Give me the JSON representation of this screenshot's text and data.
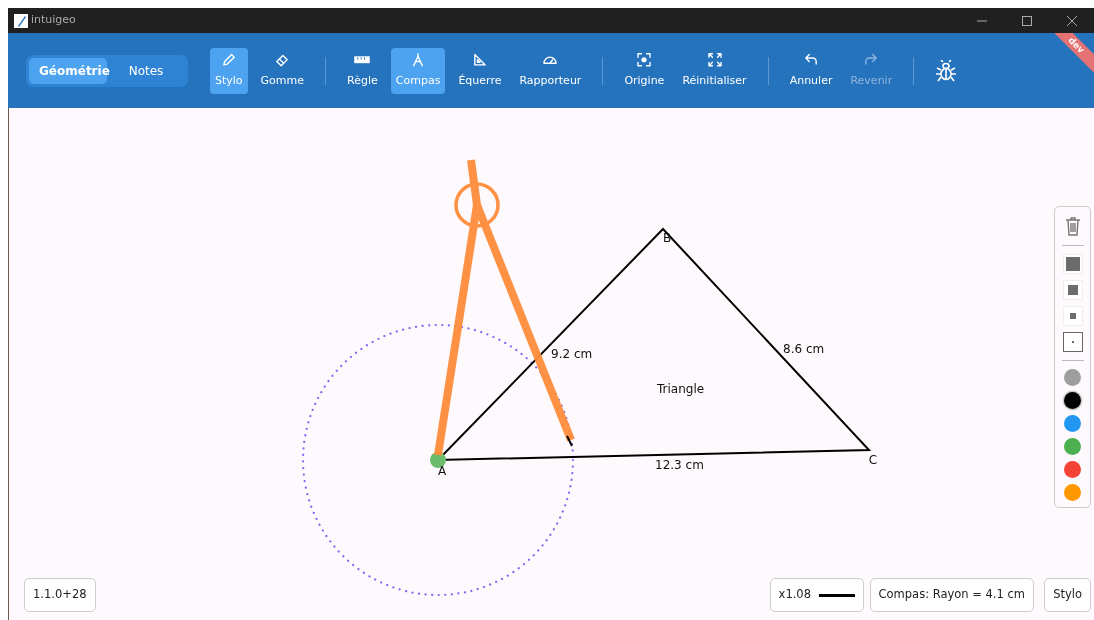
{
  "window": {
    "title": "intuigeo"
  },
  "modes": [
    {
      "label": "Géométrie",
      "selected": true
    },
    {
      "label": "Notes",
      "selected": false
    }
  ],
  "tool_groups": [
    {
      "tools": [
        {
          "kind": "pencil",
          "label": "Stylo",
          "selected": true,
          "disabled": false
        },
        {
          "kind": "eraser",
          "label": "Gomme",
          "selected": false,
          "disabled": false
        }
      ]
    },
    {
      "tools": [
        {
          "kind": "ruler",
          "label": "Règle",
          "selected": false,
          "disabled": false
        },
        {
          "kind": "compass",
          "label": "Compas",
          "selected": true,
          "disabled": false
        },
        {
          "kind": "setsquare",
          "label": "Équerre",
          "selected": false,
          "disabled": false
        },
        {
          "kind": "protractor",
          "label": "Rapporteur",
          "selected": false,
          "disabled": false
        }
      ]
    },
    {
      "tools": [
        {
          "kind": "target",
          "label": "Origine",
          "selected": false,
          "disabled": false
        },
        {
          "kind": "expand",
          "label": "Réinitialiser",
          "selected": false,
          "disabled": false
        }
      ]
    },
    {
      "tools": [
        {
          "kind": "undo",
          "label": "Annuler",
          "selected": false,
          "disabled": false
        },
        {
          "kind": "redo",
          "label": "Revenir",
          "selected": false,
          "disabled": true
        }
      ]
    }
  ],
  "ribbon": "dev",
  "drawing": {
    "points": [
      {
        "label": "A"
      },
      {
        "label": "B"
      },
      {
        "label": "C"
      }
    ],
    "lengths": [
      "9.2 cm",
      "8.6 cm",
      "12.3 cm"
    ],
    "shape_label": "Triangle"
  },
  "palette": {
    "sizes": [
      {
        "selected": false
      },
      {
        "selected": false
      },
      {
        "selected": false
      },
      {
        "selected": true
      }
    ],
    "colors": [
      {
        "color": "#9e9e9e",
        "selected": false
      },
      {
        "color": "#000000",
        "selected": true
      },
      {
        "color": "#2196f3",
        "selected": false
      },
      {
        "color": "#4caf50",
        "selected": false
      },
      {
        "color": "#f44336",
        "selected": false
      },
      {
        "color": "#ff9800",
        "selected": false
      }
    ]
  },
  "status": {
    "version": "1.1.0+28",
    "zoom": "x1.08",
    "measure": "Compas: Rayon = 4.1 cm",
    "tool": "Stylo"
  }
}
